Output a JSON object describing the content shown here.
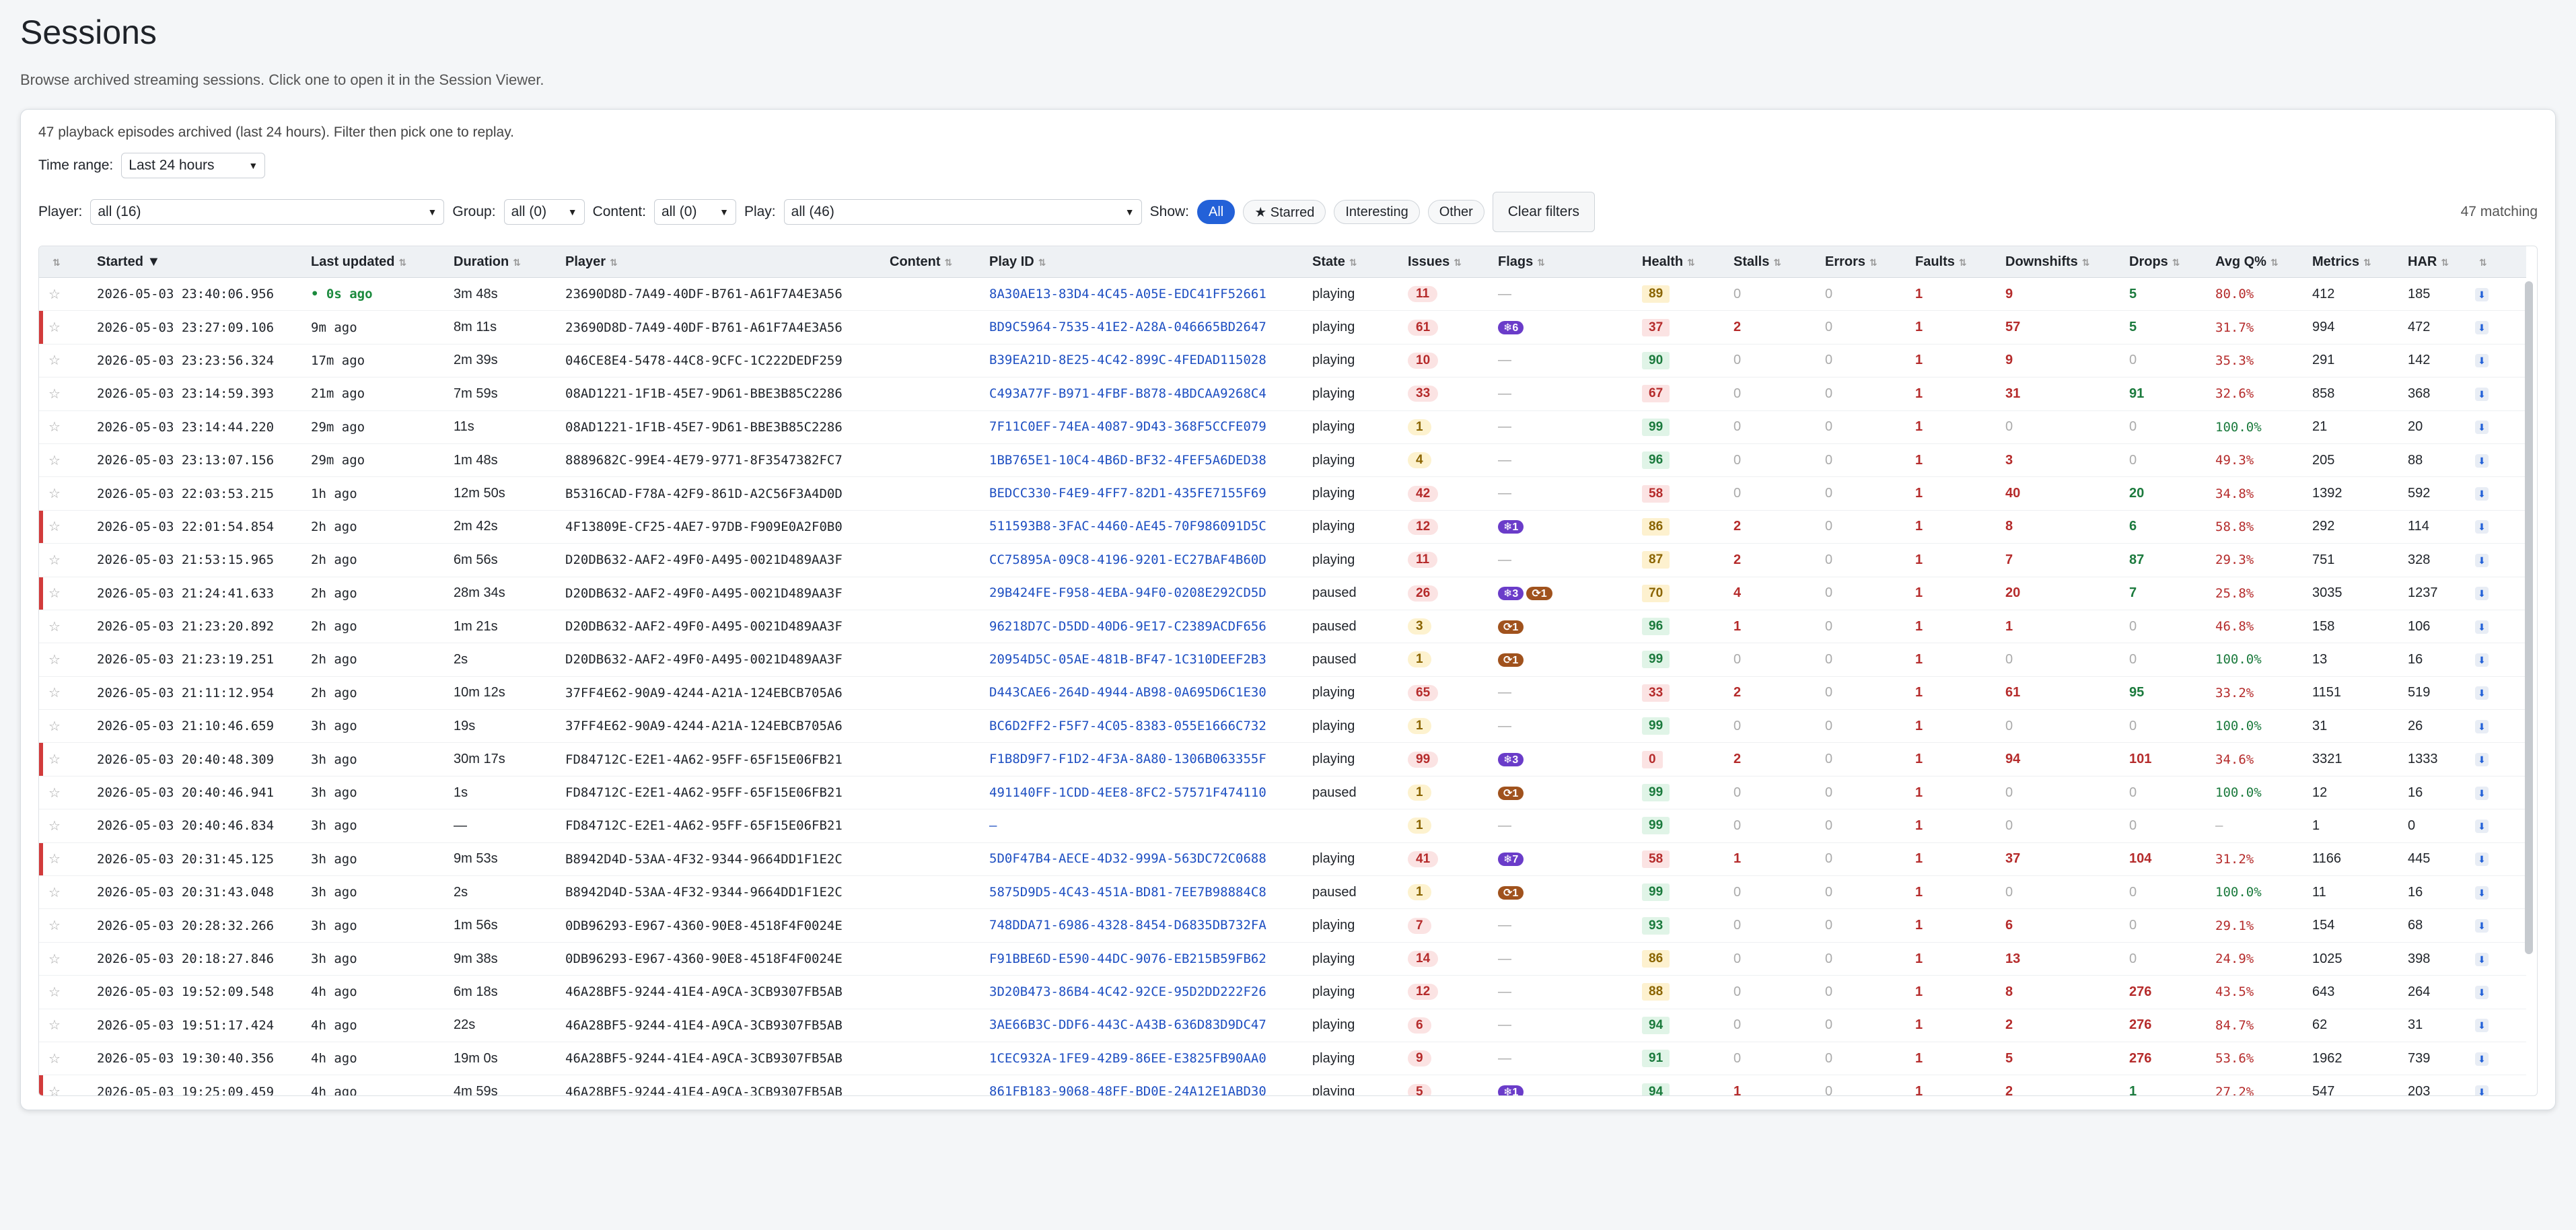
{
  "page": {
    "title": "Sessions",
    "subtitle": "Browse archived streaming sessions. Click one to open it in the Session Viewer."
  },
  "panel": {
    "summary": "47 playback episodes archived (last 24 hours). Filter then pick one to replay.",
    "time_range_label": "Time range:",
    "time_range_value": "Last 24 hours",
    "player_label": "Player:",
    "player_value": "all (16)",
    "group_label": "Group:",
    "group_value": "all (0)",
    "content_label": "Content:",
    "content_value": "all (0)",
    "play_label": "Play:",
    "play_value": "all (46)",
    "show_label": "Show:",
    "show_all": "All",
    "show_starred": "★ Starred",
    "show_interesting": "Interesting",
    "show_other": "Other",
    "clear_filters": "Clear filters",
    "matching": "47 matching"
  },
  "columns": [
    "",
    "Started ▼",
    "Last updated",
    "Duration",
    "Player",
    "Content",
    "Play ID",
    "State",
    "Issues",
    "Flags",
    "Health",
    "Stalls",
    "Errors",
    "Faults",
    "Downshifts",
    "Drops",
    "Avg Q%",
    "Metrics",
    "HAR",
    ""
  ],
  "rows": [
    {
      "marked": false,
      "started": "2026-05-03 23:40:06.956",
      "updated": "• 0s ago",
      "live": true,
      "duration": "3m 48s",
      "player": "23690D8D-7A49-40DF-B761-A61F7A4E3A56",
      "content": "",
      "play_id": "8A30AE13-83D4-4C45-A05E-EDC41FF52661",
      "state": "playing",
      "issues": "11",
      "issue_level": "red",
      "flags": [],
      "health": "89",
      "health_level": "y",
      "stalls": "0",
      "errors": "0",
      "faults": "1",
      "downshifts": "9",
      "drops": "5",
      "avgq": "80.0%",
      "metrics": "412",
      "har": "185"
    },
    {
      "marked": true,
      "started": "2026-05-03 23:27:09.106",
      "updated": "9m ago",
      "live": false,
      "duration": "8m 11s",
      "player": "23690D8D-7A49-40DF-B761-A61F7A4E3A56",
      "content": "",
      "play_id": "BD9C5964-7535-41E2-A28A-046665BD2647",
      "state": "playing",
      "issues": "61",
      "issue_level": "red",
      "flags": [
        {
          "kind": "pur",
          "text": "❄6"
        }
      ],
      "health": "37",
      "health_level": "r",
      "stalls": "2",
      "errors": "0",
      "faults": "1",
      "downshifts": "57",
      "drops": "5",
      "avgq": "31.7%",
      "metrics": "994",
      "har": "472"
    },
    {
      "marked": false,
      "started": "2026-05-03 23:23:56.324",
      "updated": "17m ago",
      "live": false,
      "duration": "2m 39s",
      "player": "046CE8E4-5478-44C8-9CFC-1C222DEDF259",
      "content": "",
      "play_id": "B39EA21D-8E25-4C42-899C-4FEDAD115028",
      "state": "playing",
      "issues": "10",
      "issue_level": "red",
      "flags": [],
      "health": "90",
      "health_level": "g",
      "stalls": "0",
      "errors": "0",
      "faults": "1",
      "downshifts": "9",
      "drops": "0",
      "avgq": "35.3%",
      "metrics": "291",
      "har": "142"
    },
    {
      "marked": false,
      "started": "2026-05-03 23:14:59.393",
      "updated": "21m ago",
      "live": false,
      "duration": "7m 59s",
      "player": "08AD1221-1F1B-45E7-9D61-BBE3B85C2286",
      "content": "",
      "play_id": "C493A77F-B971-4FBF-B878-4BDCAA9268C4",
      "state": "playing",
      "issues": "33",
      "issue_level": "red",
      "flags": [],
      "health": "67",
      "health_level": "r",
      "stalls": "0",
      "errors": "0",
      "faults": "1",
      "downshifts": "31",
      "drops": "91",
      "avgq": "32.6%",
      "metrics": "858",
      "har": "368"
    },
    {
      "marked": false,
      "started": "2026-05-03 23:14:44.220",
      "updated": "29m ago",
      "live": false,
      "duration": "11s",
      "player": "08AD1221-1F1B-45E7-9D61-BBE3B85C2286",
      "content": "",
      "play_id": "7F11C0EF-74EA-4087-9D43-368F5CCFE079",
      "state": "playing",
      "issues": "1",
      "issue_level": "yel",
      "flags": [],
      "health": "99",
      "health_level": "g",
      "stalls": "0",
      "errors": "0",
      "faults": "1",
      "downshifts": "0",
      "drops": "0",
      "avgq": "100.0%",
      "metrics": "21",
      "har": "20"
    },
    {
      "marked": false,
      "started": "2026-05-03 23:13:07.156",
      "updated": "29m ago",
      "live": false,
      "duration": "1m 48s",
      "player": "8889682C-99E4-4E79-9771-8F3547382FC7",
      "content": "",
      "play_id": "1BB765E1-10C4-4B6D-BF32-4FEF5A6DED38",
      "state": "playing",
      "issues": "4",
      "issue_level": "yel",
      "flags": [],
      "health": "96",
      "health_level": "g",
      "stalls": "0",
      "errors": "0",
      "faults": "1",
      "downshifts": "3",
      "drops": "0",
      "avgq": "49.3%",
      "metrics": "205",
      "har": "88"
    },
    {
      "marked": false,
      "started": "2026-05-03 22:03:53.215",
      "updated": "1h ago",
      "live": false,
      "duration": "12m 50s",
      "player": "B5316CAD-F78A-42F9-861D-A2C56F3A4D0D",
      "content": "",
      "play_id": "BEDCC330-F4E9-4FF7-82D1-435FE7155F69",
      "state": "playing",
      "issues": "42",
      "issue_level": "red",
      "flags": [],
      "health": "58",
      "health_level": "r",
      "stalls": "0",
      "errors": "0",
      "faults": "1",
      "downshifts": "40",
      "drops": "20",
      "avgq": "34.8%",
      "metrics": "1392",
      "har": "592"
    },
    {
      "marked": true,
      "started": "2026-05-03 22:01:54.854",
      "updated": "2h ago",
      "live": false,
      "duration": "2m 42s",
      "player": "4F13809E-CF25-4AE7-97DB-F909E0A2F0B0",
      "content": "",
      "play_id": "511593B8-3FAC-4460-AE45-70F986091D5C",
      "state": "playing",
      "issues": "12",
      "issue_level": "red",
      "flags": [
        {
          "kind": "pur",
          "text": "❄1"
        }
      ],
      "health": "86",
      "health_level": "y",
      "stalls": "2",
      "errors": "0",
      "faults": "1",
      "downshifts": "8",
      "drops": "6",
      "avgq": "58.8%",
      "metrics": "292",
      "har": "114"
    },
    {
      "marked": false,
      "started": "2026-05-03 21:53:15.965",
      "updated": "2h ago",
      "live": false,
      "duration": "6m 56s",
      "player": "D20DB632-AAF2-49F0-A495-0021D489AA3F",
      "content": "",
      "play_id": "CC75895A-09C8-4196-9201-EC27BAF4B60D",
      "state": "playing",
      "issues": "11",
      "issue_level": "red",
      "flags": [],
      "health": "87",
      "health_level": "y",
      "stalls": "2",
      "errors": "0",
      "faults": "1",
      "downshifts": "7",
      "drops": "87",
      "avgq": "29.3%",
      "metrics": "751",
      "har": "328"
    },
    {
      "marked": true,
      "started": "2026-05-03 21:24:41.633",
      "updated": "2h ago",
      "live": false,
      "duration": "28m 34s",
      "player": "D20DB632-AAF2-49F0-A495-0021D489AA3F",
      "content": "",
      "play_id": "29B424FE-F958-4EBA-94F0-0208E292CD5D",
      "state": "paused",
      "issues": "26",
      "issue_level": "red",
      "flags": [
        {
          "kind": "pur",
          "text": "❄3"
        },
        {
          "kind": "brn",
          "text": "⟳1"
        }
      ],
      "health": "70",
      "health_level": "y",
      "stalls": "4",
      "errors": "0",
      "faults": "1",
      "downshifts": "20",
      "drops": "7",
      "avgq": "25.8%",
      "metrics": "3035",
      "har": "1237"
    },
    {
      "marked": false,
      "started": "2026-05-03 21:23:20.892",
      "updated": "2h ago",
      "live": false,
      "duration": "1m 21s",
      "player": "D20DB632-AAF2-49F0-A495-0021D489AA3F",
      "content": "",
      "play_id": "96218D7C-D5DD-40D6-9E17-C2389ACDF656",
      "state": "paused",
      "issues": "3",
      "issue_level": "yel",
      "flags": [
        {
          "kind": "brn",
          "text": "⟳1"
        }
      ],
      "health": "96",
      "health_level": "g",
      "stalls": "1",
      "errors": "0",
      "faults": "1",
      "downshifts": "1",
      "drops": "0",
      "avgq": "46.8%",
      "metrics": "158",
      "har": "106"
    },
    {
      "marked": false,
      "started": "2026-05-03 21:23:19.251",
      "updated": "2h ago",
      "live": false,
      "duration": "2s",
      "player": "D20DB632-AAF2-49F0-A495-0021D489AA3F",
      "content": "",
      "play_id": "20954D5C-05AE-481B-BF47-1C310DEEF2B3",
      "state": "paused",
      "issues": "1",
      "issue_level": "yel",
      "flags": [
        {
          "kind": "brn",
          "text": "⟳1"
        }
      ],
      "health": "99",
      "health_level": "g",
      "stalls": "0",
      "errors": "0",
      "faults": "1",
      "downshifts": "0",
      "drops": "0",
      "avgq": "100.0%",
      "metrics": "13",
      "har": "16"
    },
    {
      "marked": false,
      "started": "2026-05-03 21:11:12.954",
      "updated": "2h ago",
      "live": false,
      "duration": "10m 12s",
      "player": "37FF4E62-90A9-4244-A21A-124EBCB705A6",
      "content": "",
      "play_id": "D443CAE6-264D-4944-AB98-0A695D6C1E30",
      "state": "playing",
      "issues": "65",
      "issue_level": "red",
      "flags": [],
      "health": "33",
      "health_level": "r",
      "stalls": "2",
      "errors": "0",
      "faults": "1",
      "downshifts": "61",
      "drops": "95",
      "avgq": "33.2%",
      "metrics": "1151",
      "har": "519"
    },
    {
      "marked": false,
      "started": "2026-05-03 21:10:46.659",
      "updated": "3h ago",
      "live": false,
      "duration": "19s",
      "player": "37FF4E62-90A9-4244-A21A-124EBCB705A6",
      "content": "",
      "play_id": "BC6D2FF2-F5F7-4C05-8383-055E1666C732",
      "state": "playing",
      "issues": "1",
      "issue_level": "yel",
      "flags": [],
      "health": "99",
      "health_level": "g",
      "stalls": "0",
      "errors": "0",
      "faults": "1",
      "downshifts": "0",
      "drops": "0",
      "avgq": "100.0%",
      "metrics": "31",
      "har": "26"
    },
    {
      "marked": true,
      "started": "2026-05-03 20:40:48.309",
      "updated": "3h ago",
      "live": false,
      "duration": "30m 17s",
      "player": "FD84712C-E2E1-4A62-95FF-65F15E06FB21",
      "content": "",
      "play_id": "F1B8D9F7-F1D2-4F3A-8A80-1306B063355F",
      "state": "playing",
      "issues": "99",
      "issue_level": "red",
      "flags": [
        {
          "kind": "pur",
          "text": "❄3"
        }
      ],
      "health": "0",
      "health_level": "r",
      "stalls": "2",
      "errors": "0",
      "faults": "1",
      "downshifts": "94",
      "drops": "101",
      "avgq": "34.6%",
      "metrics": "3321",
      "har": "1333"
    },
    {
      "marked": false,
      "started": "2026-05-03 20:40:46.941",
      "updated": "3h ago",
      "live": false,
      "duration": "1s",
      "player": "FD84712C-E2E1-4A62-95FF-65F15E06FB21",
      "content": "",
      "play_id": "491140FF-1CDD-4EE8-8FC2-57571F474110",
      "state": "paused",
      "issues": "1",
      "issue_level": "yel",
      "flags": [
        {
          "kind": "brn",
          "text": "⟳1"
        }
      ],
      "health": "99",
      "health_level": "g",
      "stalls": "0",
      "errors": "0",
      "faults": "1",
      "downshifts": "0",
      "drops": "0",
      "avgq": "100.0%",
      "metrics": "12",
      "har": "16"
    },
    {
      "marked": false,
      "started": "2026-05-03 20:40:46.834",
      "updated": "3h ago",
      "live": false,
      "duration": "—",
      "player": "FD84712C-E2E1-4A62-95FF-65F15E06FB21",
      "content": "",
      "play_id": "—",
      "state": "",
      "issues": "1",
      "issue_level": "yel",
      "flags": [],
      "health": "99",
      "health_level": "g",
      "stalls": "0",
      "errors": "0",
      "faults": "1",
      "downshifts": "0",
      "drops": "0",
      "avgq": "—",
      "metrics": "1",
      "har": "0"
    },
    {
      "marked": true,
      "started": "2026-05-03 20:31:45.125",
      "updated": "3h ago",
      "live": false,
      "duration": "9m 53s",
      "player": "B8942D4D-53AA-4F32-9344-9664DD1F1E2C",
      "content": "",
      "play_id": "5D0F47B4-AECE-4D32-999A-563DC72C0688",
      "state": "playing",
      "issues": "41",
      "issue_level": "red",
      "flags": [
        {
          "kind": "pur",
          "text": "❄7"
        }
      ],
      "health": "58",
      "health_level": "r",
      "stalls": "1",
      "errors": "0",
      "faults": "1",
      "downshifts": "37",
      "drops": "104",
      "avgq": "31.2%",
      "metrics": "1166",
      "har": "445"
    },
    {
      "marked": false,
      "started": "2026-05-03 20:31:43.048",
      "updated": "3h ago",
      "live": false,
      "duration": "2s",
      "player": "B8942D4D-53AA-4F32-9344-9664DD1F1E2C",
      "content": "",
      "play_id": "5875D9D5-4C43-451A-BD81-7EE7B98884C8",
      "state": "paused",
      "issues": "1",
      "issue_level": "yel",
      "flags": [
        {
          "kind": "brn",
          "text": "⟳1"
        }
      ],
      "health": "99",
      "health_level": "g",
      "stalls": "0",
      "errors": "0",
      "faults": "1",
      "downshifts": "0",
      "drops": "0",
      "avgq": "100.0%",
      "metrics": "11",
      "har": "16"
    },
    {
      "marked": false,
      "started": "2026-05-03 20:28:32.266",
      "updated": "3h ago",
      "live": false,
      "duration": "1m 56s",
      "player": "0DB96293-E967-4360-90E8-4518F4F0024E",
      "content": "",
      "play_id": "748DDA71-6986-4328-8454-D6835DB732FA",
      "state": "playing",
      "issues": "7",
      "issue_level": "red",
      "flags": [],
      "health": "93",
      "health_level": "g",
      "stalls": "0",
      "errors": "0",
      "faults": "1",
      "downshifts": "6",
      "drops": "0",
      "avgq": "29.1%",
      "metrics": "154",
      "har": "68"
    },
    {
      "marked": false,
      "started": "2026-05-03 20:18:27.846",
      "updated": "3h ago",
      "live": false,
      "duration": "9m 38s",
      "player": "0DB96293-E967-4360-90E8-4518F4F0024E",
      "content": "",
      "play_id": "F91BBE6D-E590-44DC-9076-EB215B59FB62",
      "state": "playing",
      "issues": "14",
      "issue_level": "red",
      "flags": [],
      "health": "86",
      "health_level": "y",
      "stalls": "0",
      "errors": "0",
      "faults": "1",
      "downshifts": "13",
      "drops": "0",
      "avgq": "24.9%",
      "metrics": "1025",
      "har": "398"
    },
    {
      "marked": false,
      "started": "2026-05-03 19:52:09.548",
      "updated": "4h ago",
      "live": false,
      "duration": "6m 18s",
      "player": "46A28BF5-9244-41E4-A9CA-3CB9307FB5AB",
      "content": "",
      "play_id": "3D20B473-86B4-4C42-92CE-95D2DD222F26",
      "state": "playing",
      "issues": "12",
      "issue_level": "red",
      "flags": [],
      "health": "88",
      "health_level": "y",
      "stalls": "0",
      "errors": "0",
      "faults": "1",
      "downshifts": "8",
      "drops": "276",
      "avgq": "43.5%",
      "metrics": "643",
      "har": "264"
    },
    {
      "marked": false,
      "started": "2026-05-03 19:51:17.424",
      "updated": "4h ago",
      "live": false,
      "duration": "22s",
      "player": "46A28BF5-9244-41E4-A9CA-3CB9307FB5AB",
      "content": "",
      "play_id": "3AE66B3C-DDF6-443C-A43B-636D83D9DC47",
      "state": "playing",
      "issues": "6",
      "issue_level": "red",
      "flags": [],
      "health": "94",
      "health_level": "g",
      "stalls": "0",
      "errors": "0",
      "faults": "1",
      "downshifts": "2",
      "drops": "276",
      "avgq": "84.7%",
      "metrics": "62",
      "har": "31"
    },
    {
      "marked": false,
      "started": "2026-05-03 19:30:40.356",
      "updated": "4h ago",
      "live": false,
      "duration": "19m 0s",
      "player": "46A28BF5-9244-41E4-A9CA-3CB9307FB5AB",
      "content": "",
      "play_id": "1CEC932A-1FE9-42B9-86EE-E3825FB90AA0",
      "state": "playing",
      "issues": "9",
      "issue_level": "red",
      "flags": [],
      "health": "91",
      "health_level": "g",
      "stalls": "0",
      "errors": "0",
      "faults": "1",
      "downshifts": "5",
      "drops": "276",
      "avgq": "53.6%",
      "metrics": "1962",
      "har": "739"
    },
    {
      "marked": true,
      "started": "2026-05-03 19:25:09.459",
      "updated": "4h ago",
      "live": false,
      "duration": "4m 59s",
      "player": "46A28BF5-9244-41E4-A9CA-3CB9307FB5AB",
      "content": "",
      "play_id": "861FB183-9068-48FF-BD0E-24A12E1ABD30",
      "state": "playing",
      "issues": "5",
      "issue_level": "red",
      "flags": [
        {
          "kind": "pur",
          "text": "❄1"
        }
      ],
      "health": "94",
      "health_level": "g",
      "stalls": "1",
      "errors": "0",
      "faults": "1",
      "downshifts": "2",
      "drops": "1",
      "avgq": "27.2%",
      "metrics": "547",
      "har": "203"
    }
  ]
}
